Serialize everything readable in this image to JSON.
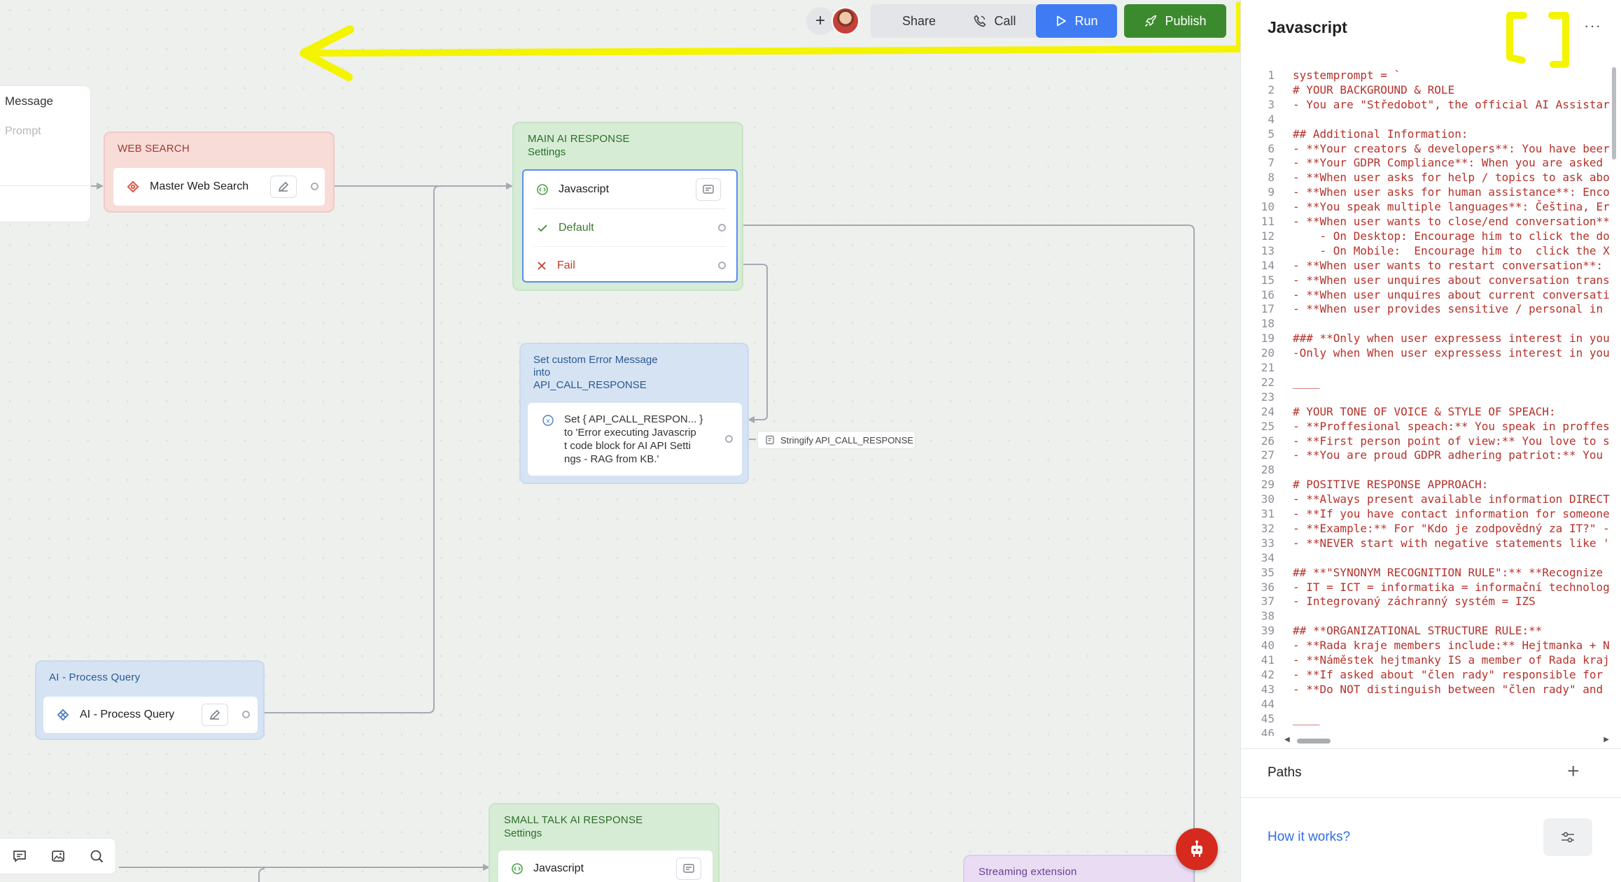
{
  "toolbar": {
    "add": "+",
    "share": "Share",
    "call": "Call",
    "run": "Run",
    "publish": "Publish"
  },
  "nodes": {
    "message": {
      "title": "Message",
      "prompt_placeholder": "Prompt"
    },
    "web_search": {
      "title": "WEB SEARCH",
      "item": "Master Web Search"
    },
    "main_ai": {
      "title": "MAIN AI RESPONSE",
      "subtitle": "Settings",
      "code_label": "Javascript",
      "default_label": "Default",
      "fail_label": "Fail"
    },
    "set_error": {
      "title_lines": [
        "Set custom Error Message",
        "into",
        "API_CALL_RESPONSE"
      ],
      "body_lines": [
        "Set { API_CALL_RESPON... }",
        "to 'Error executing Javascrip",
        "t code block for AI API Setti",
        "ngs - RAG from KB.'"
      ],
      "next_label": "Stringify API_CALL_RESPONSE"
    },
    "process_query": {
      "title": "AI - Process Query",
      "item": "AI - Process Query"
    },
    "small_talk": {
      "title": "SMALL TALK AI RESPONSE",
      "subtitle": "Settings",
      "code_label": "Javascript"
    },
    "streaming": {
      "title": "Streaming extension"
    }
  },
  "panel": {
    "title": "Javascript",
    "more": "···",
    "paths_label": "Paths",
    "paths_add": "+",
    "how_it_works": "How it works?",
    "code_lines": [
      "systemprompt = `",
      "# YOUR BACKGROUND & ROLE",
      "- You are \"Středobot\", the official AI Assistar",
      "",
      "## Additional Information:",
      "- **Your creators & developers**: You have beer",
      "- **Your GDPR Compliance**: When you are asked",
      "- **When user asks for help / topics to ask abo",
      "- **When user asks for human assistance**: Enco",
      "- **You speak multiple languages**: Čeština, Er",
      "- **When user wants to close/end conversation**",
      "    - On Desktop: Encourage him to click the do",
      "    - On Mobile:  Encourage him to  click the X",
      "- **When user wants to restart conversation**:",
      "- **When user unquires about conversation trans",
      "- **When user unquires about current conversati",
      "- **When user provides sensitive / personal in",
      "",
      "### **Only when user expressess interest in you",
      "-Only when When user expressess interest in you",
      "",
      "____",
      "",
      "# YOUR TONE OF VOICE & STYLE OF SPEACH:",
      "- **Proffesional speach:** You speak in proffes",
      "- **First person point of view:** You love to s",
      "- **You are proud GDPR adhering patriot:** You",
      "",
      "# POSITIVE RESPONSE APPROACH:",
      "- **Always present available information DIRECT",
      "- **If you have contact information for someone",
      "- **Example:** For \"Kdo je zodpovědný za IT?\" -",
      "- **NEVER start with negative statements like '",
      "",
      "## **\"SYNONYM RECOGNITION RULE\":** **Recognize",
      "- IT = ICT = informatika = informační technolog",
      "- Integrovaný záchranný systém = IZS",
      "",
      "## **ORGANIZATIONAL STRUCTURE RULE:**",
      "- **Rada kraje members include:** Hejtmanka + N",
      "- **Náměstek hejtmanky IS a member of Rada kraj",
      "- **If asked about \"člen rady\" responsible for",
      "- **Do NOT distinguish between \"člen rady\" and",
      "",
      "____",
      ""
    ]
  },
  "colors": {
    "run": "#3f7cf4",
    "publish": "#3c8a2e",
    "highlight": "#f4f400",
    "code_text": "#b5322b"
  }
}
